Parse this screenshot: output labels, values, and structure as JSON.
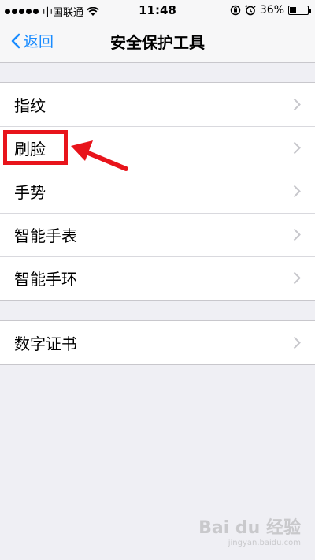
{
  "status_bar": {
    "carrier": "中国联通",
    "time": "11:48",
    "battery": "36%",
    "battery_level": 0.36
  },
  "nav": {
    "back_label": "返回",
    "title": "安全保护工具"
  },
  "groups": [
    {
      "items": [
        "指纹",
        "刷脸",
        "手势",
        "智能手表",
        "智能手环"
      ]
    },
    {
      "items": [
        "数字证书"
      ]
    }
  ],
  "annotation": {
    "highlighted_item": "刷脸",
    "color": "#e8141b"
  },
  "watermark": {
    "logo": "Bai du 经验",
    "url": "jingyan.baidu.com"
  },
  "colors": {
    "accent": "#1a8cff",
    "background": "#efeff4"
  }
}
